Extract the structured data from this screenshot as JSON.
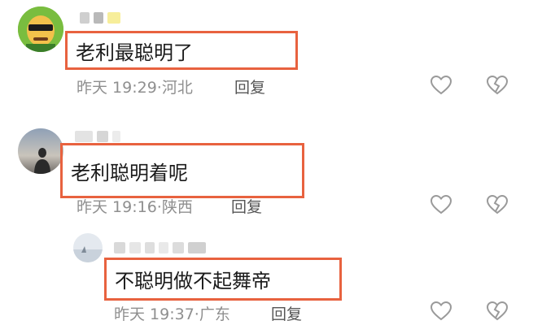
{
  "comments": [
    {
      "text": "老利最聪明了",
      "time": "昨天 19:29",
      "location": "河北",
      "reply_label": "回复"
    },
    {
      "text": "老利聪明着呢",
      "time": "昨天 19:16",
      "location": "陕西",
      "reply_label": "回复"
    },
    {
      "text": "不聪明做不起舞帝",
      "time": "昨天 19:37",
      "location": "广东",
      "reply_label": "回复"
    }
  ],
  "meta_separator": "·",
  "colors": {
    "highlight_border": "#e8623f",
    "meta_text": "#8f8f8f",
    "icon_stroke": "#9a9a9a"
  },
  "icons": {
    "like": "heart-outline-icon",
    "dislike": "broken-heart-icon"
  }
}
